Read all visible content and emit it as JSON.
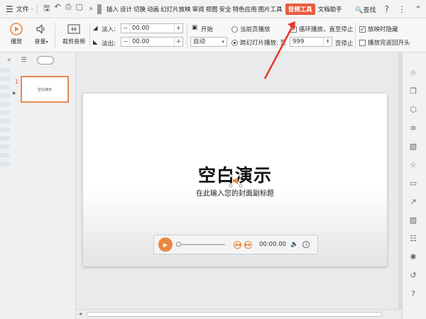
{
  "menubar": {
    "file_label": "文件",
    "tabs": [
      "插入",
      "设计",
      "切换",
      "动画",
      "幻灯片放映",
      "审阅",
      "视图",
      "安全",
      "特色应用",
      "图片工具"
    ],
    "active_tab": "音频工具",
    "doc_helper": "文档助手",
    "search_label": "查找"
  },
  "ribbon": {
    "play_label": "播放",
    "volume_label": "音量",
    "trim_label": "裁剪音频",
    "fade_in_label": "淡入:",
    "fade_in_value": "00.00",
    "fade_out_label": "淡出:",
    "fade_out_value": "00.00",
    "start_label": "开始",
    "start_value": "自动",
    "current_page_label": "当前页播放",
    "cross_slide_label": "跨幻灯片播放: 至",
    "cross_slide_value": "999",
    "page_stop_label": "页停止",
    "loop_label": "循环播放，直至停止",
    "hide_label": "放映时隐藏",
    "rewind_label": "播放完返回开头"
  },
  "slides_panel": {
    "slide_number": "1",
    "thumb_title": "空白演示"
  },
  "slide": {
    "title": "空白演示",
    "subtitle": "在此输入您的封面副标题"
  },
  "player": {
    "time": "00:00.00"
  },
  "colors": {
    "accent": "#e85d3d",
    "player_orange": "#e9873f",
    "annotation_red": "#e8372b"
  }
}
